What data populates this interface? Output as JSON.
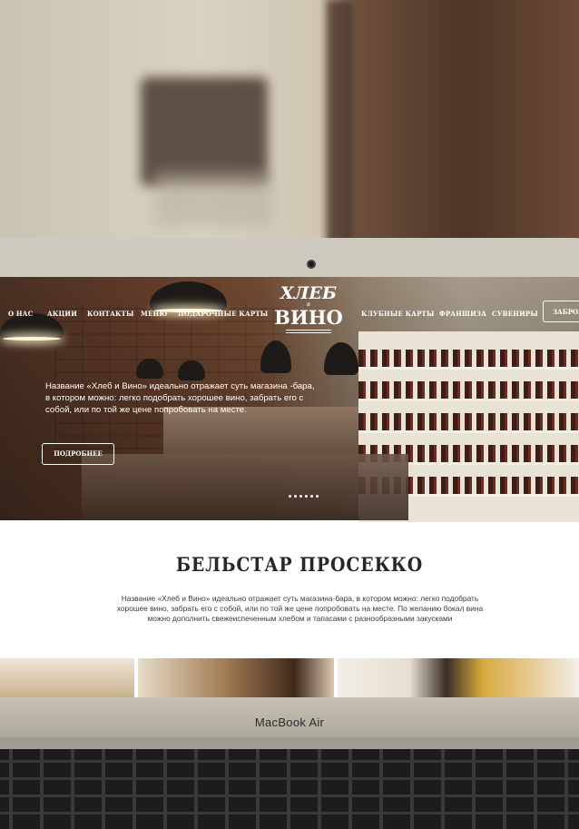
{
  "nav": {
    "left": [
      "О НАС",
      "АКЦИИ",
      "КОНТАКТЫ",
      "МЕНЮ",
      "ПОДАРОЧНЫЕ КАРТЫ"
    ],
    "right": [
      "КЛУБНЫЕ КАРТЫ",
      "ФРАНШИЗА",
      "СУВЕНИРЫ"
    ],
    "reserve_label": "ЗАБРОН"
  },
  "logo": {
    "line1": "ХЛЕБ",
    "mid": "и",
    "line2": "ВИНО"
  },
  "hero": {
    "text": "Название «Хлеб и Вино» идеально отражает суть магазина -бара, в котором можно: легко подобрать хорошее вино, забрать его с собой, или по той же цене попробовать на месте.",
    "more_label": "ПОДРОБНЕЕ"
  },
  "section": {
    "title": "БЕЛЬСТАР ПРОСЕККО",
    "text": "Название «Хлеб и Вино» идеально отражает суть магазина-бара, в котором можно: легко подобрать хорошее вино, забрать его с собой, или по той же цене попробовать на месте. По желанию бокал вина можно дополнить свежеиспеченным хлебом и тапасами с разнообразными закусками"
  },
  "laptop": {
    "brand": "MacBook Air"
  }
}
